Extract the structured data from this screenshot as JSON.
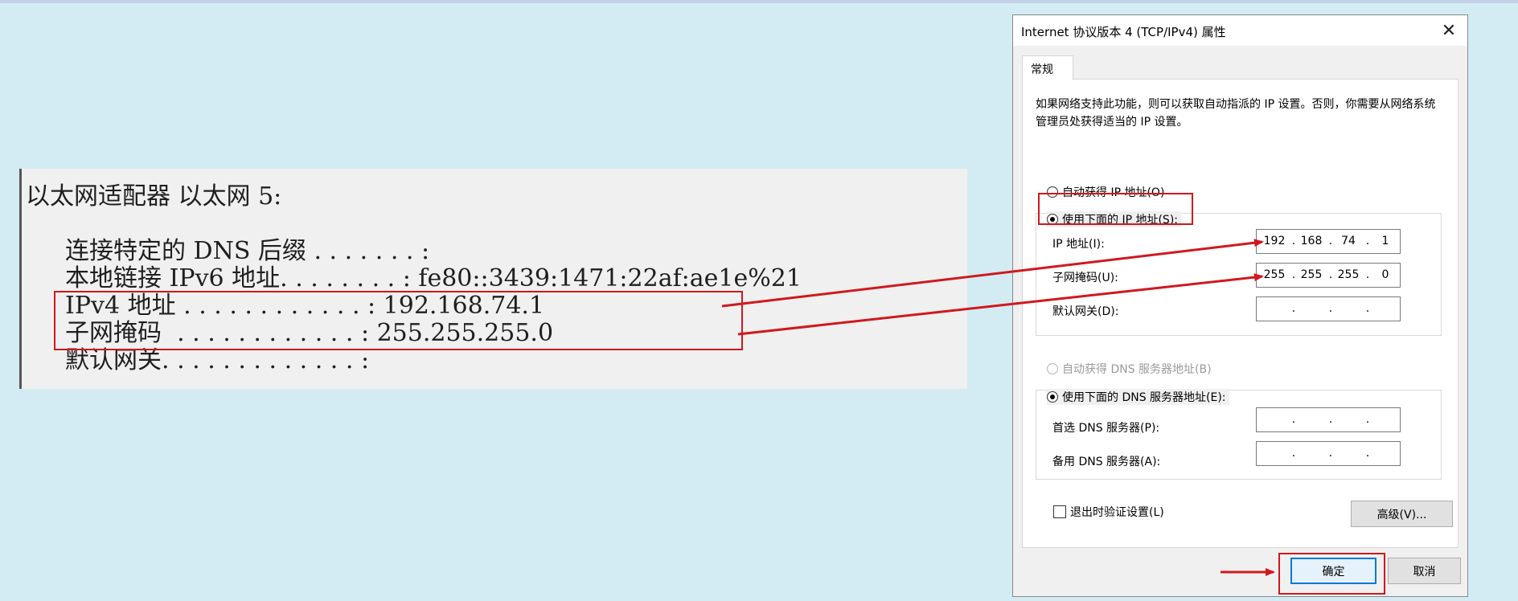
{
  "console": {
    "heading": "以太网适配器 以太网 5:",
    "lines": [
      "连接特定的 DNS 后缀 . . . . . . . :",
      "本地链接 IPv6 地址. . . . . . . . : fe80::3439:1471:22af:ae1e%21",
      "IPv4 地址 . . . . . . . . . . . . : 192.168.74.1",
      "子网掩码  . . . . . . . . . . . . : 255.255.255.0",
      "默认网关. . . . . . . . . . . . . :"
    ]
  },
  "dialog": {
    "title": "Internet 协议版本 4 (TCP/IPv4) 属性",
    "close_glyph": "✕",
    "tab": "常规",
    "description": "如果网络支持此功能，则可以获取自动指派的 IP 设置。否则，你需要从网络系统管理员处获得适当的 IP 设置。",
    "radio_auto_ip": "自动获得 IP 地址(O)",
    "radio_manual_ip": "使用下面的 IP 地址(S):",
    "ip_label": "IP 地址(I):",
    "ip_value": [
      "192",
      "168",
      "74",
      "1"
    ],
    "mask_label": "子网掩码(U):",
    "mask_value": [
      "255",
      "255",
      "255",
      "0"
    ],
    "gateway_label": "默认网关(D):",
    "radio_auto_dns": "自动获得 DNS 服务器地址(B)",
    "radio_manual_dns": "使用下面的 DNS 服务器地址(E):",
    "preferred_dns_label": "首选 DNS 服务器(P):",
    "alternate_dns_label": "备用 DNS 服务器(A):",
    "validate_checkbox": "退出时验证设置(L)",
    "advanced_button": "高级(V)...",
    "ok_button": "确定",
    "cancel_button": "取消"
  },
  "colors": {
    "background": "#d3ecf3",
    "annotation": "#d0181e",
    "accent": "#0078d7"
  }
}
